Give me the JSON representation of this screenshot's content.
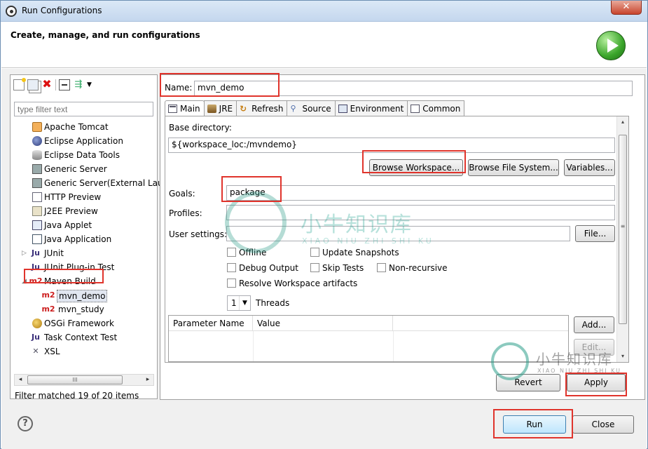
{
  "window": {
    "title": "Run Configurations",
    "close_glyph": "✕"
  },
  "header": {
    "subtitle": "Create, manage, and run configurations"
  },
  "left_panel": {
    "filter_placeholder": "type filter text",
    "items": [
      {
        "label": "Apache Tomcat",
        "icon": "tomcat-icon"
      },
      {
        "label": "Eclipse Application",
        "icon": "eclipse-icon"
      },
      {
        "label": "Eclipse Data Tools",
        "icon": "database-icon"
      },
      {
        "label": "Generic Server",
        "icon": "server-icon"
      },
      {
        "label": "Generic Server(External Lau",
        "icon": "server-icon"
      },
      {
        "label": "HTTP Preview",
        "icon": "page-icon"
      },
      {
        "label": "J2EE Preview",
        "icon": "page-icon"
      },
      {
        "label": "Java Applet",
        "icon": "applet-icon"
      },
      {
        "label": "Java Application",
        "icon": "java-app-icon"
      },
      {
        "label": "JUnit",
        "icon": "junit-icon",
        "glyph": "Ju"
      },
      {
        "label": "JUnit Plug-in Test",
        "icon": "junit-plugin-icon",
        "glyph": "Ju"
      },
      {
        "label": "Maven Build",
        "icon": "maven-icon",
        "glyph": "m2"
      },
      {
        "label": "mvn_demo",
        "icon": "maven-icon",
        "glyph": "m2"
      },
      {
        "label": "mvn_study",
        "icon": "maven-icon",
        "glyph": "m2"
      },
      {
        "label": "OSGi Framework",
        "icon": "osgi-icon"
      },
      {
        "label": "Task Context Test",
        "icon": "junit-icon",
        "glyph": "Ju"
      },
      {
        "label": "XSL",
        "icon": "xsl-icon",
        "glyph": "✕"
      }
    ],
    "twisty_collapsed": "▷",
    "twisty_expanded": "◢",
    "scroll_thumb_grip": "III",
    "scroll_left": "◂",
    "scroll_right": "▸",
    "status": "Filter matched 19 of 20 items"
  },
  "right_panel": {
    "name_label": "Name:",
    "name_value": "mvn_demo",
    "tabs": [
      {
        "label": "Main",
        "icon": "main-tab-icon"
      },
      {
        "label": "JRE",
        "icon": "jre-icon"
      },
      {
        "label": "Refresh",
        "icon": "refresh-icon"
      },
      {
        "label": "Source",
        "icon": "source-icon"
      },
      {
        "label": "Environment",
        "icon": "environment-icon"
      },
      {
        "label": "Common",
        "icon": "common-icon"
      }
    ],
    "base_directory_label": "Base directory:",
    "base_directory_value": "${workspace_loc:/mvndemo}",
    "browse_workspace": "Browse Workspace...",
    "browse_file_system": "Browse File System...",
    "variables": "Variables...",
    "goals_label": "Goals:",
    "goals_value": "package",
    "profiles_label": "Profiles:",
    "profiles_value": "",
    "user_settings_label": "User settings:",
    "user_settings_value": "",
    "file_button": "File...",
    "checkboxes": {
      "offline": "Offline",
      "update_snapshots": "Update Snapshots",
      "debug_output": "Debug Output",
      "skip_tests": "Skip Tests",
      "non_recursive": "Non-recursive",
      "resolve_workspace": "Resolve Workspace artifacts"
    },
    "threads_value": "1",
    "threads_label": "Threads",
    "param_table": {
      "columns": [
        "Parameter Name",
        "Value"
      ]
    },
    "add_button": "Add...",
    "edit_button": "Edit...",
    "scroll_up": "▴",
    "scroll_down": "▾",
    "scroll_grip": "≡",
    "revert_button": "Revert",
    "apply_button": "Apply"
  },
  "footer": {
    "help_glyph": "?",
    "run_button": "Run",
    "close_button": "Close"
  },
  "watermark": {
    "brand": "小牛知识库",
    "brand_pinyin": "XIAO NIU ZHI SHI KU"
  },
  "colors": {
    "highlight": "#e0342c",
    "maven_red": "#cc1e1e"
  }
}
